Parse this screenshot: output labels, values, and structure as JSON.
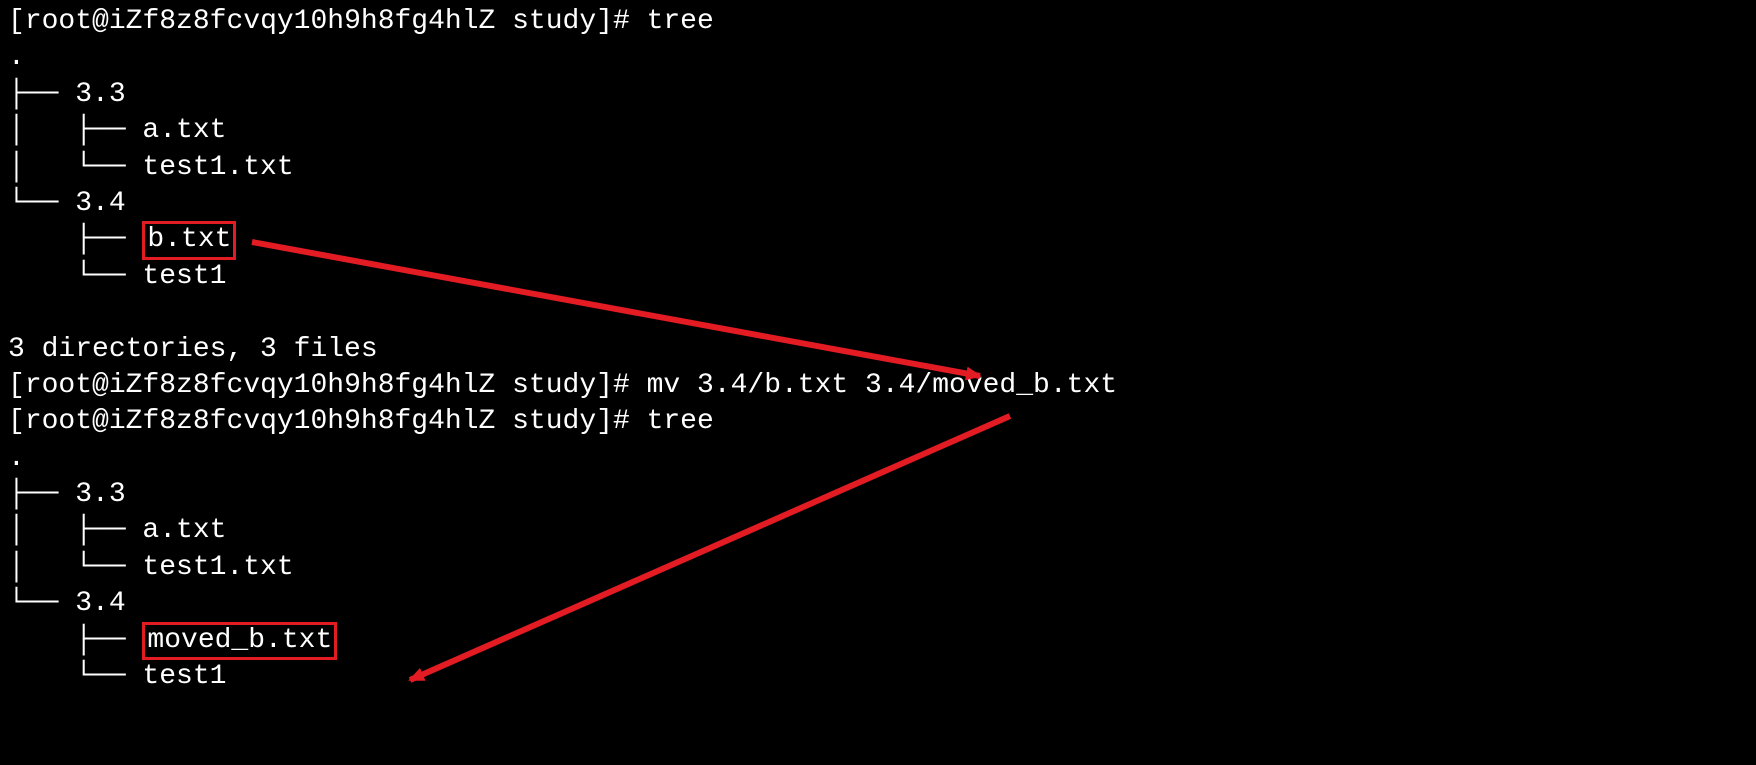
{
  "prompt": {
    "user": "root",
    "host": "iZf8z8fcvqy10h9h8fg4hlZ",
    "cwd": "study",
    "sym": "#"
  },
  "cmd": {
    "tree": "tree",
    "mv": "mv 3.4/b.txt 3.4/moved_b.txt"
  },
  "tree1": {
    "dot": ".",
    "d1": "├── 3.3",
    "d1a": "│   ├── a.txt",
    "d1b": "│   └── test1.txt",
    "d2": "└── 3.4",
    "d2a_prefix": "    ├── ",
    "d2a_file": "b.txt",
    "d2b": "    └── test1",
    "summary": "3 directories, 3 files"
  },
  "tree2": {
    "dot": ".",
    "d1": "├── 3.3",
    "d1a": "│   ├── a.txt",
    "d1b": "│   └── test1.txt",
    "d2": "└── 3.4",
    "d2a_prefix": "    ├── ",
    "d2a_file": "moved_b.txt",
    "d2b": "    └── test1"
  },
  "annotation": {
    "color": "#e31b23"
  }
}
